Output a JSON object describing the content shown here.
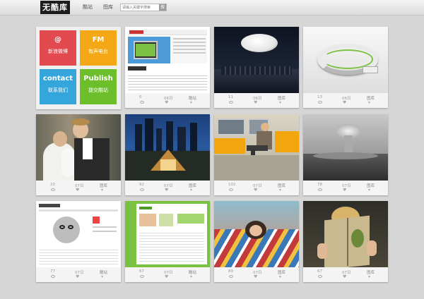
{
  "header": {
    "logo": "无酷库",
    "nav": [
      "酷站",
      "图库"
    ],
    "search_placeholder": "请输入关键字搜索",
    "search_button": "搜"
  },
  "tiles": [
    {
      "big": "@",
      "small": "新浪微博",
      "color": "#e24a4f"
    },
    {
      "big": "FM",
      "small": "有声电台",
      "color": "#f5a815"
    },
    {
      "big": "contact",
      "small": "联系我们",
      "color": "#35a6dc"
    },
    {
      "big": "Publish",
      "small": "提交酷站",
      "color": "#6cbf2a"
    }
  ],
  "cards": [
    {
      "views": "",
      "date": "",
      "category": ""
    },
    {
      "views": "0",
      "date": "06日",
      "category": "酷站"
    },
    {
      "views": "11",
      "date": "06日",
      "category": "图库"
    },
    {
      "views": "13",
      "date": "06日",
      "category": "图库"
    },
    {
      "views": "20",
      "date": "07日",
      "category": "图库"
    },
    {
      "views": "92",
      "date": "07日",
      "category": "图库"
    },
    {
      "views": "102",
      "date": "07日",
      "category": "图库"
    },
    {
      "views": "78",
      "date": "07日",
      "category": "图库"
    },
    {
      "views": "77",
      "date": "07日",
      "category": "酷站"
    },
    {
      "views": "67",
      "date": "07日",
      "category": "酷站"
    },
    {
      "views": "89",
      "date": "07日",
      "category": "图库"
    },
    {
      "views": "67",
      "date": "07日",
      "category": "图库"
    }
  ]
}
